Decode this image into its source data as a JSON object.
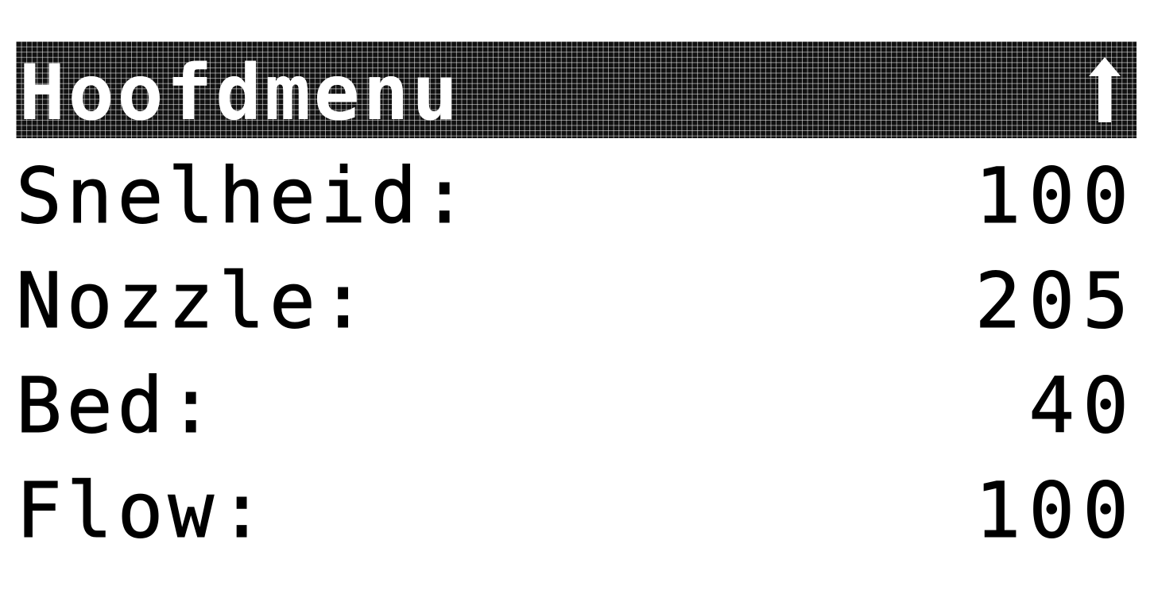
{
  "header": {
    "title": "Hoofdmenu",
    "back_icon": "arrow-up-icon"
  },
  "rows": [
    {
      "label": "Snelheid:",
      "value": "100"
    },
    {
      "label": "Nozzle:",
      "value": "205"
    },
    {
      "label": "Bed:",
      "value": "40"
    },
    {
      "label": "Flow:",
      "value": "100"
    }
  ],
  "colors": {
    "background": "#ffffff",
    "header_bg": "#111111",
    "text": "#000000",
    "header_text": "#ffffff"
  }
}
